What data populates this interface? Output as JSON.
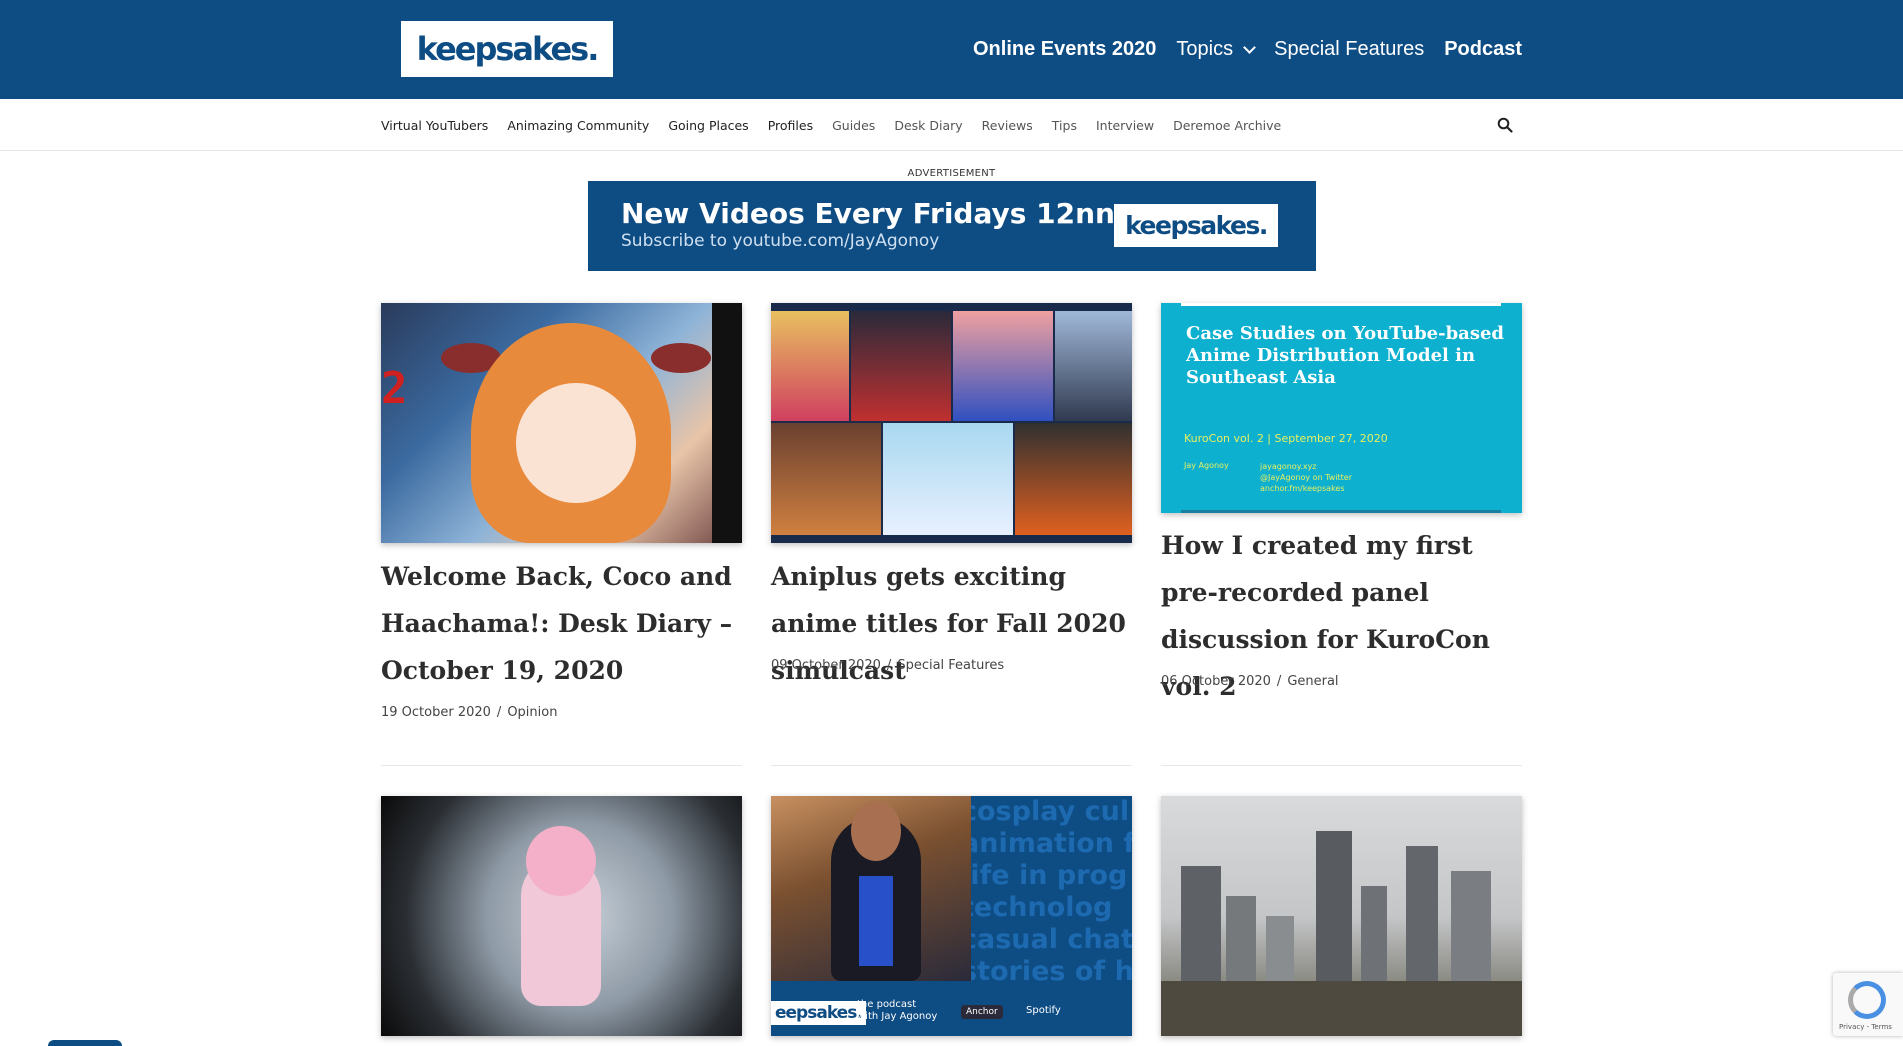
{
  "header": {
    "logo": "keepsakes.",
    "nav": [
      {
        "label": "Online Events 2020"
      },
      {
        "label": "Topics"
      },
      {
        "label": "Special Features"
      },
      {
        "label": "Podcast"
      }
    ]
  },
  "subnav": {
    "items": [
      {
        "label": "Virtual YouTubers"
      },
      {
        "label": "Animazing Community"
      },
      {
        "label": "Going Places"
      },
      {
        "label": "Profiles"
      },
      {
        "label": "Guides"
      },
      {
        "label": "Desk Diary"
      },
      {
        "label": "Reviews"
      },
      {
        "label": "Tips"
      },
      {
        "label": "Interview"
      },
      {
        "label": "Deremoe Archive"
      }
    ],
    "search_icon": "search-icon"
  },
  "ad": {
    "label": "ADVERTISEMENT",
    "title": "New Videos Every Fridays 12nn",
    "subtitle": "Subscribe to youtube.com/JayAgonoy",
    "logo": "keepsakes."
  },
  "cards": [
    {
      "title": "Welcome Back, Coco and Haachama!: Desk Diary – October 19, 2020",
      "date": "19 October 2020",
      "category": "Opinion",
      "thumb_text": "2"
    },
    {
      "title": "Aniplus gets exciting anime titles for Fall 2020 simulcast",
      "date": "09 October 2020",
      "category": "Special Features"
    },
    {
      "title": "How I created my first pre-recorded panel discussion for KuroCon vol. 2",
      "date": "06 October 2020",
      "category": "General",
      "slide": {
        "title": "Case Studies on YouTube-based Anime Distribution Model in Southeast Asia",
        "subtitle": "KuroCon vol. 2 | September 27, 2020",
        "author": "Jay Agonoy",
        "links": [
          "jayagonoy.xyz",
          "@JayAgonoy on Twitter",
          "anchor.fm/keepsakes"
        ]
      }
    },
    {
      "title": "",
      "date": "",
      "category": ""
    },
    {
      "title": "",
      "date": "",
      "category": "",
      "podcast": {
        "words": [
          "cosplay cul",
          "animation fa",
          "life in prog",
          "technolog",
          "casual chat",
          "stories of h"
        ],
        "logo": "eepsakes.",
        "text": [
          "the podcast",
          "with Jay Agonoy"
        ],
        "anchor": "Anchor",
        "spotify": "Spotify"
      }
    },
    {
      "title": "",
      "date": "",
      "category": ""
    }
  ],
  "separator": "/",
  "recaptcha": {
    "text": "Privacy - Terms"
  },
  "colors": {
    "brand": "#0e4c84",
    "slide": "#0db0cf"
  }
}
